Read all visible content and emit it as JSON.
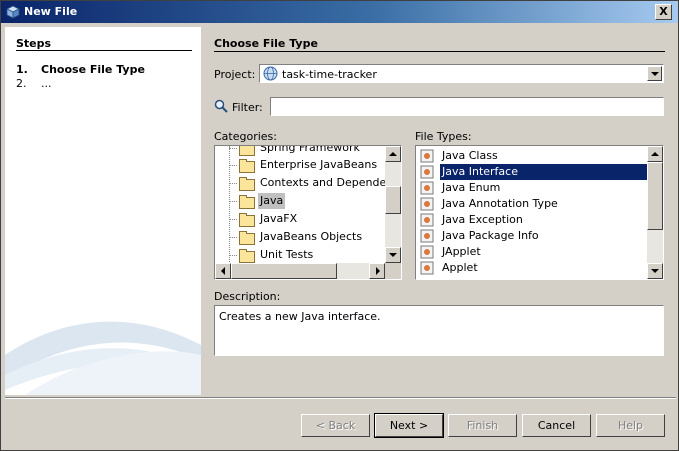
{
  "window": {
    "title": "New File",
    "close_label": "X"
  },
  "steps": {
    "title": "Steps",
    "items": [
      {
        "num": "1.",
        "label": "Choose File Type"
      },
      {
        "num": "2.",
        "label": "..."
      }
    ]
  },
  "main": {
    "title": "Choose File Type",
    "project_label": "Project:",
    "project_value": "task-time-tracker",
    "filter_label": "Filter:",
    "filter_value": "",
    "categories_label": "Categories:",
    "file_types_label": "File Types:",
    "description_label": "Description:",
    "description_text": "Creates a new Java interface."
  },
  "categories": [
    "Spring Framework",
    "Enterprise JavaBeans",
    "Contexts and Dependency",
    "Java",
    "JavaFX",
    "JavaBeans Objects",
    "Unit Tests"
  ],
  "categories_selected": "Java",
  "file_types": [
    "Java Class",
    "Java Interface",
    "Java Enum",
    "Java Annotation Type",
    "Java Exception",
    "Java Package Info",
    "JApplet",
    "Applet"
  ],
  "file_types_selected": "Java Interface",
  "buttons": {
    "back": "< Back",
    "next": "Next >",
    "finish": "Finish",
    "cancel": "Cancel",
    "help": "Help"
  },
  "colors": {
    "title_bar": "#0a246a",
    "selection": "#0a246a",
    "face": "#d4d0c8"
  }
}
